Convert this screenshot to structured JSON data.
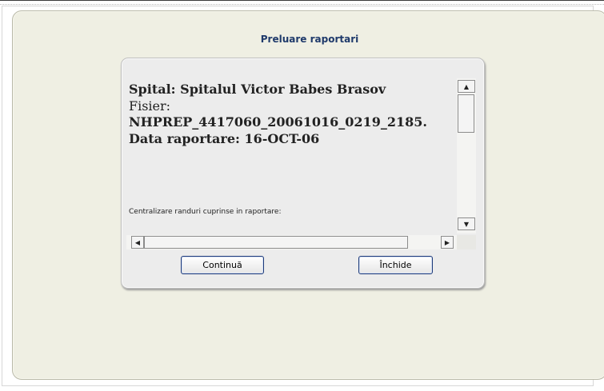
{
  "page": {
    "title": "Preluare raportari"
  },
  "report": {
    "hospital_line": "Spital: Spitalul Victor Babes Brasov",
    "file_label": "Fisier:",
    "file_name": "NHPREP_4417060_20061016_0219_2185.",
    "date_line": "Data raportare: 16-OCT-06",
    "summary_label": "Centralizare randuri cuprinse in raportare:"
  },
  "scroll": {
    "up_arrow": "▲",
    "down_arrow": "▼",
    "left_arrow": "◀",
    "right_arrow": "▶"
  },
  "buttons": {
    "continue": "Continuă",
    "close": "Închide"
  }
}
